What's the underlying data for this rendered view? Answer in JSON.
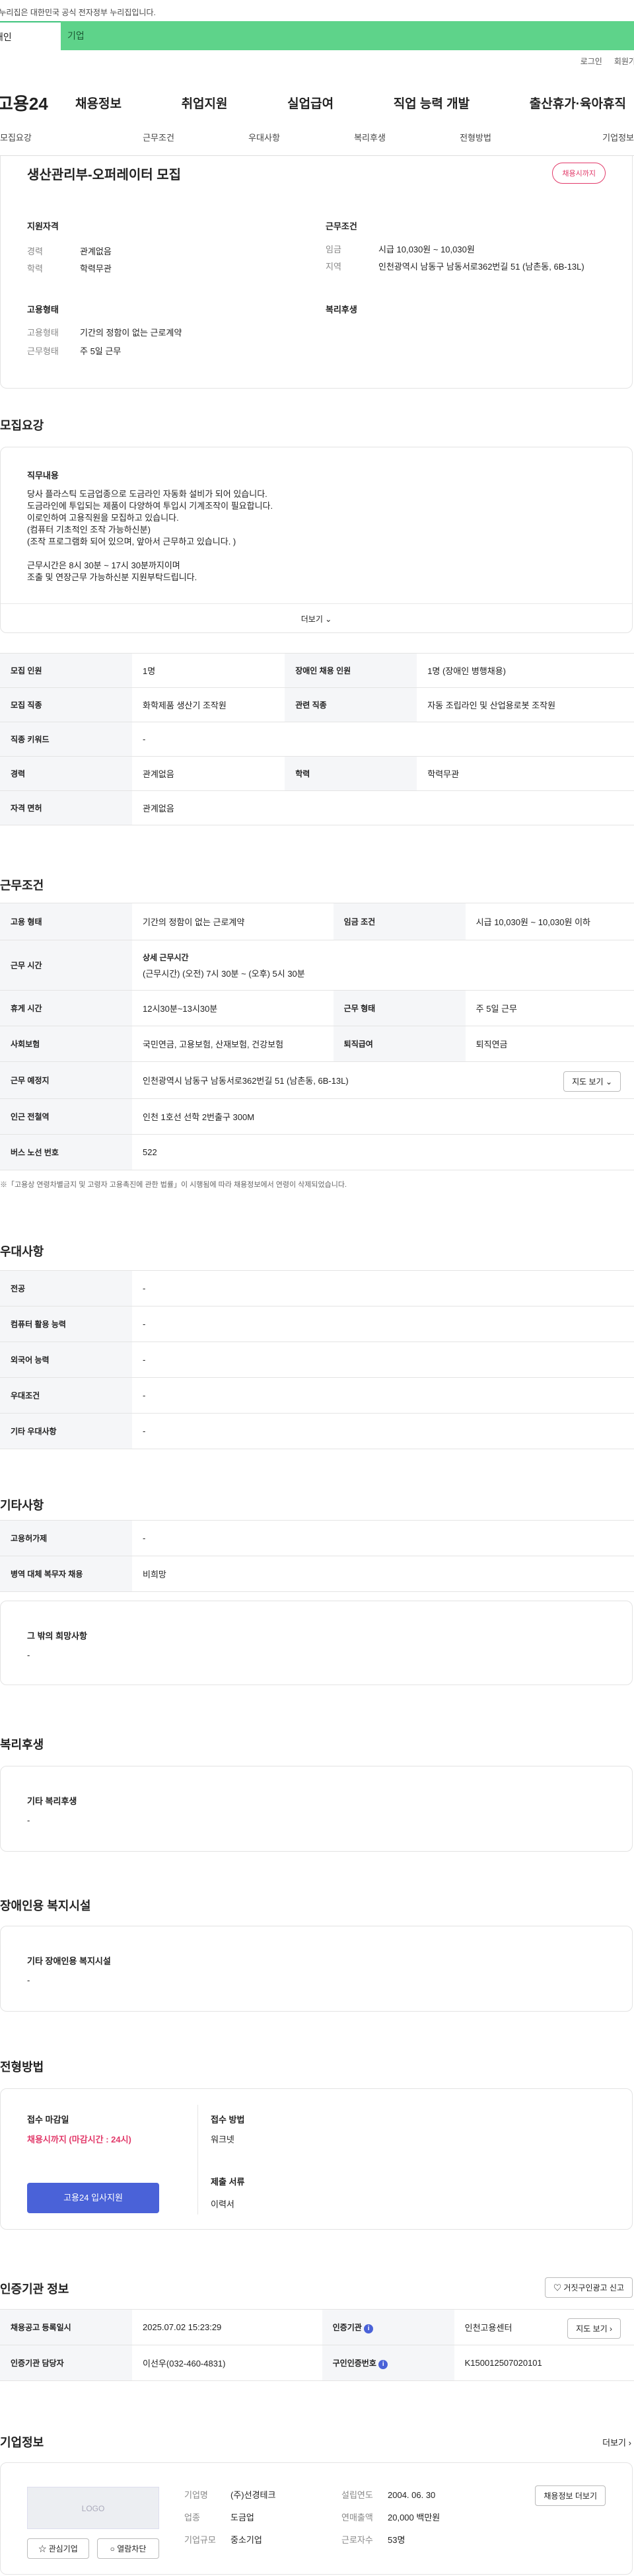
{
  "top": {
    "notice": "이 누리집은 대한민국 공식 전자정부 누리집입니다.",
    "tab_person": "개인",
    "tab_company": "기업"
  },
  "util": {
    "login": "로그인",
    "join": "회원가입"
  },
  "gnb": {
    "logo": "고용24",
    "menu": [
      "채용정보",
      "취업지원",
      "실업급여",
      "직업 능력 개발",
      "출산휴가·육아휴직"
    ]
  },
  "snb": [
    "모집요강",
    "근무조건",
    "우대사항",
    "복리후생",
    "전형방법",
    "기업정보"
  ],
  "job": {
    "title": "생산관리부-오퍼레이터 모집",
    "status_badge": "채용시까지",
    "qual_title": "지원자격",
    "cond_title": "근무조건",
    "career_label": "경력",
    "career": "관계없음",
    "edu_label": "학력",
    "edu": "학력무관",
    "wage_label": "임금",
    "wage": "시급 10,030원 ~ 10,030원",
    "loc_label": "지역",
    "loc": "인천광역시 남동구 남동서로362번길 51 (남촌동, 6B-13L)",
    "emp_title": "고용형태",
    "welfare_title": "복리후생",
    "emptype_label": "고용형태",
    "emptype": "기간의 정함이 없는 근로계약",
    "worktype_label": "근무형태",
    "worktype": "주 5일 근무"
  },
  "recruit": {
    "section": "모집요강",
    "duty_title": "직무내용",
    "duty_lines": [
      "당사 플라스틱 도금업종으로 도금라인 자동화 설비가 되어 있습니다.",
      "도금라인에 투입되는 제품이 다양하여 투입시 기계조작이 필요합니다.",
      "이로인하여 고용직원을 모집하고 있습니다.",
      "(컴퓨터 기초적인 조작 가능하신분)",
      "(조작 프로그램화 되어 있으며, 앞아서 근무하고 있습니다. )",
      "",
      "근무시간은 8시 30분 ~ 17시 30분까지이며",
      "조출 및 연장근무 가능하신분 지원부탁드립니다."
    ],
    "more": "더보기",
    "rows": [
      {
        "h1": "모집 인원",
        "v1": "1명",
        "h2": "장애인 채용 인원",
        "v2": "1명 (장애인 병행채용)"
      },
      {
        "h1": "모집 직종",
        "v1": "화학제품 생산기 조작원",
        "h2": "관련 직종",
        "v2": "자동 조립라인 및 산업용로봇 조작원"
      },
      {
        "h1": "직종 키워드",
        "v1": "-",
        "h2": "",
        "v2": ""
      },
      {
        "h1": "경력",
        "v1": "관계없음",
        "h2": "학력",
        "v2": "학력무관"
      },
      {
        "h1": "자격 면허",
        "v1": "관계없음",
        "h2": "",
        "v2": ""
      }
    ]
  },
  "work": {
    "section": "근무조건",
    "emptype_h": "고용 형태",
    "emptype": "기간의 정함이 없는 근로계약",
    "wage_h": "임금 조건",
    "wage": "시급 10,030원 ~ 10,030원 이하",
    "hours_h": "근무 시간",
    "hours_sub": "상세 근무시간",
    "hours": "(근무시간) (오전) 7시 30분 ~ (오후) 5시 30분",
    "rest_h": "휴게 시간",
    "rest": "12시30분~13시30분",
    "form_h": "근무 형태",
    "form": "주 5일 근무",
    "ins_h": "사회보험",
    "ins": "국민연금, 고용보험, 산재보험, 건강보험",
    "sev_h": "퇴직급여",
    "sev": "퇴직연금",
    "place_h": "근무 예정지",
    "place": "인천광역시 남동구 남동서로362번길 51 (남촌동, 6B-13L)",
    "map_btn": "지도 보기",
    "subway_h": "인근 전철역",
    "subway": "인천 1호선 선학 2번출구 300M",
    "bus_h": "버스 노선 번호",
    "bus": "522",
    "note": "※「고용상 연령차별금지 및 고령자 고용촉진에 관한 법률」이 시행됨에 따라 채용정보에서 연령이 삭제되었습니다."
  },
  "pref": {
    "section": "우대사항",
    "rows": [
      {
        "h": "전공",
        "v": "-"
      },
      {
        "h": "컴퓨터 활용 능력",
        "v": "-"
      },
      {
        "h": "외국어 능력",
        "v": "-"
      },
      {
        "h": "우대조건",
        "v": "-"
      },
      {
        "h": "기타 우대사항",
        "v": "-"
      }
    ]
  },
  "etc": {
    "section": "기타사항",
    "rows": [
      {
        "h": "고용허가제",
        "v": "-"
      },
      {
        "h": "병역 대체 복무자 채용",
        "v": "비희망"
      }
    ],
    "wish_title": "그 밖의 희망사항",
    "wish": "-"
  },
  "welfare": {
    "section": "복리후생",
    "title": "기타 복리후생",
    "value": "-"
  },
  "disab": {
    "section": "장애인용 복지시설",
    "title": "기타 장애인용 복지시설",
    "value": "-"
  },
  "process": {
    "section": "전형방법",
    "deadline_h": "접수 마감일",
    "deadline": "채용시까지 (마감시간 : 24시)",
    "apply_btn": "고용24 입사지원",
    "method_h": "접수 방법",
    "method": "워크넷",
    "docs_h": "제출 서류",
    "docs": "이력서"
  },
  "cert": {
    "section": "인증기관 정보",
    "report_btn": "거짓구인광고 신고",
    "reg_h": "채용공고 등록일시",
    "reg": "2025.07.02 15:23:29",
    "org_h": "인증기관",
    "org": "인천고용센터",
    "map_btn": "지도 보기",
    "mgr_h": "인증기관 담당자",
    "mgr": "이선우(032-460-4831)",
    "num_h": "구인인증번호",
    "num": "K150012507020101"
  },
  "company": {
    "section": "기업정보",
    "more": "더보기",
    "logo": "LOGO",
    "fav": "관심기업",
    "block": "열람차단",
    "name_h": "기업명",
    "name": "(주)선경테크",
    "year_h": "설립연도",
    "year": "2004. 06. 30",
    "ind_h": "업종",
    "ind": "도금업",
    "sales_h": "연매출액",
    "sales": "20,000 백만원",
    "size_h": "기업규모",
    "size": "중소기업",
    "emp_h": "근로자수",
    "emp": "53명",
    "jobs_btn": "채용정보 더보기"
  }
}
